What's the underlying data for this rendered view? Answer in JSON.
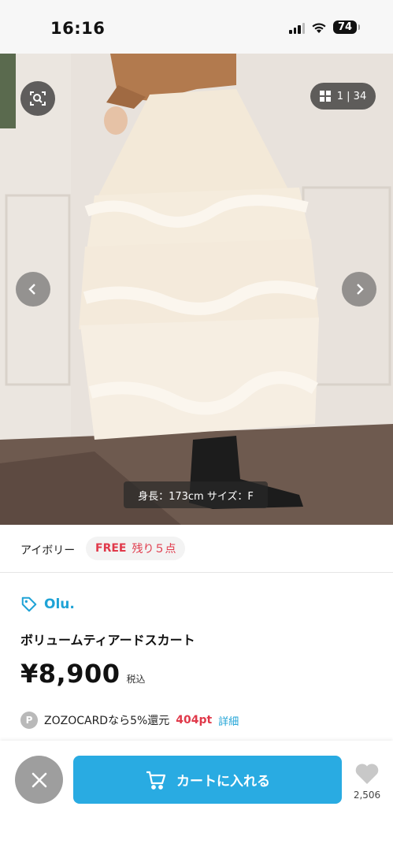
{
  "status_bar": {
    "time": "16:16",
    "battery": "74"
  },
  "gallery": {
    "counter": "1 | 34",
    "caption": "身長：173cm サイズ：F"
  },
  "variant": {
    "color_label": "アイボリー",
    "size": "FREE",
    "stock": "残り５点"
  },
  "product": {
    "brand": "Olu.",
    "name": "ボリュームティアードスカート",
    "price": "¥8,900",
    "tax_label": "税込"
  },
  "points": {
    "badge": "P",
    "text": "ZOZOCARDなら5%還元",
    "amount": "404pt",
    "detail_link": "詳細"
  },
  "actions": {
    "cart_label": "カートに入れる",
    "favorite_count": "2,506"
  },
  "colors": {
    "accent": "#29abe2",
    "brand_text": "#1fa3d6",
    "sale_red": "#e0394a"
  },
  "icons": [
    "visual-search-icon",
    "grid-icon",
    "chevron-left-icon",
    "chevron-right-icon",
    "tag-icon",
    "close-icon",
    "cart-icon",
    "heart-icon"
  ]
}
